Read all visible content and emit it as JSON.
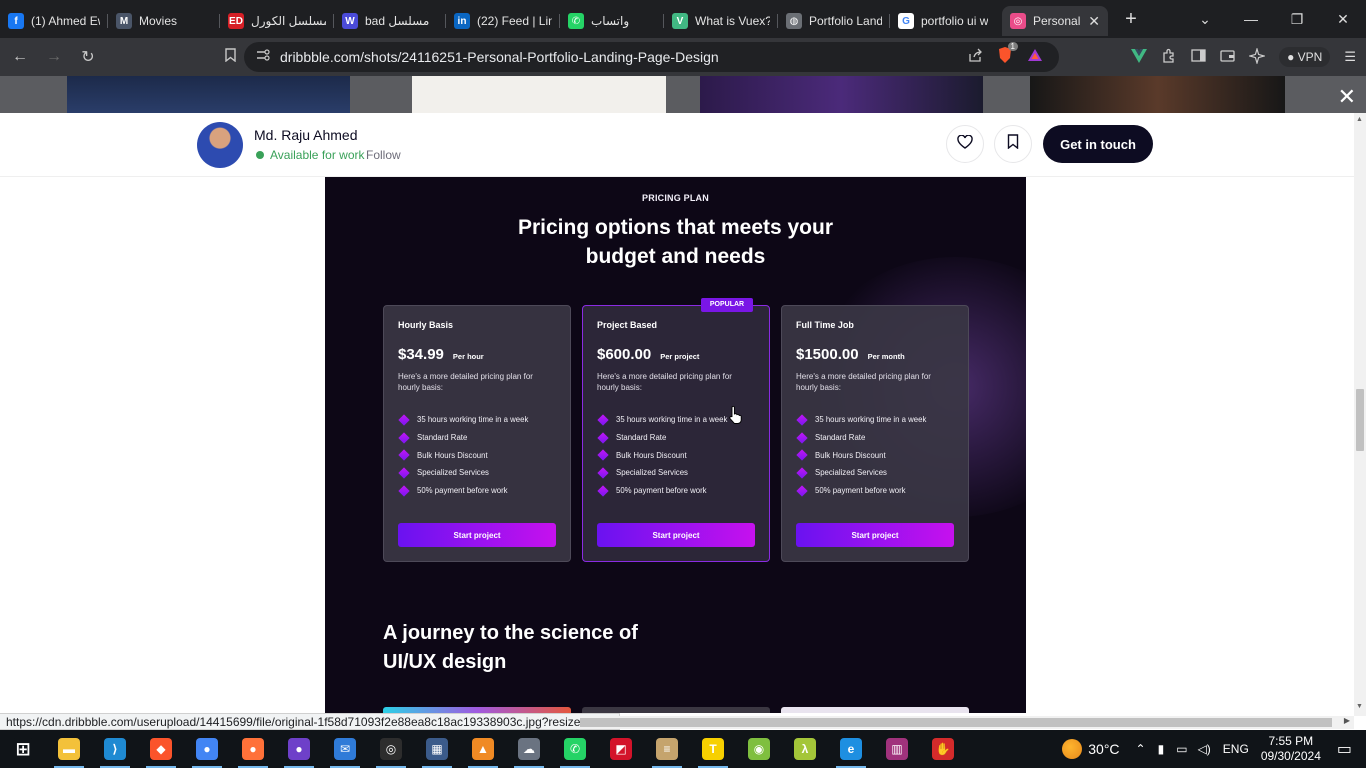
{
  "browser": {
    "tabs": [
      {
        "title": "(1) Ahmed Ew",
        "icon": "facebook-icon",
        "color": "#1877f2",
        "glyph": "f"
      },
      {
        "title": "Movies",
        "icon": "movies-icon",
        "color": "#4a5568",
        "glyph": "M"
      },
      {
        "title": "مسلسل الكورل",
        "icon": "ed-icon",
        "color": "#d61f26",
        "glyph": "ED"
      },
      {
        "title": "bad مسلسل",
        "icon": "w-icon",
        "color": "#4b4bd8",
        "glyph": "W"
      },
      {
        "title": "(22) Feed | Lin",
        "icon": "linkedin-icon",
        "color": "#0a66c2",
        "glyph": "in"
      },
      {
        "title": "واتساب",
        "icon": "whatsapp-icon",
        "color": "#25d366",
        "glyph": "✆"
      },
      {
        "title": "What is Vuex?",
        "icon": "vue-icon",
        "color": "#41b883",
        "glyph": "V"
      },
      {
        "title": "Portfolio Land",
        "icon": "globe-icon",
        "color": "#6b6f75",
        "glyph": "◍"
      },
      {
        "title": "portfolio ui w",
        "icon": "google-icon",
        "color": "#ffffff",
        "glyph": "G"
      },
      {
        "title": "Personal",
        "icon": "dribbble-icon",
        "color": "#ea4c89",
        "glyph": "◎"
      }
    ],
    "url": "dribbble.com/shots/24116251-Personal-Portfolio-Landing-Page-Design",
    "vpn_label": "VPN",
    "brave_badge": "1"
  },
  "shot_header": {
    "designer_name": "Md. Raju Ahmed",
    "availability": "Available for work",
    "follow": "Follow",
    "cta": "Get in touch"
  },
  "shot": {
    "eyebrow": "PRICING PLAN",
    "heading_line1": "Pricing options that meets your",
    "heading_line2": "budget and needs",
    "plans": [
      {
        "name": "Hourly Basis",
        "price": "$34.99",
        "period": "Per hour",
        "desc": "Here's a more detailed pricing plan for hourly basis:",
        "features": [
          "35 hours working time in a week",
          "Standard Rate",
          "Bulk Hours Discount",
          "Specialized Services",
          "50% payment before work"
        ],
        "button": "Start project"
      },
      {
        "name": "Project Based",
        "badge": "POPULAR",
        "price": "$600.00",
        "period": "Per project",
        "desc": "Here's a more detailed pricing plan for hourly basis:",
        "features": [
          "35 hours working time in a week",
          "Standard Rate",
          "Bulk Hours Discount",
          "Specialized Services",
          "50% payment before work"
        ],
        "button": "Start project"
      },
      {
        "name": "Full Time Job",
        "price": "$1500.00",
        "period": "Per month",
        "desc": "Here's a more detailed pricing plan for hourly basis:",
        "features": [
          "35 hours working time in a week",
          "Standard Rate",
          "Bulk Hours Discount",
          "Specialized Services",
          "50% payment before work"
        ],
        "button": "Start project"
      }
    ],
    "journey_line1": "A journey to the science of",
    "journey_line2": "UI/UX design"
  },
  "status_url": "https://cdn.dribbble.com/userupload/14415699/file/original-1f58d71093f2e88ea8c18ac19338903c.jpg?resize=752x",
  "taskbar": {
    "apps": [
      {
        "name": "start",
        "color": "#101418",
        "glyph": "⊞"
      },
      {
        "name": "file-explorer",
        "color": "#f3c13a",
        "glyph": "▬"
      },
      {
        "name": "vscode",
        "color": "#1f8ad2",
        "glyph": "⟩"
      },
      {
        "name": "brave",
        "color": "#fb542b",
        "glyph": "◆"
      },
      {
        "name": "chrome",
        "color": "#4285f4",
        "glyph": "●"
      },
      {
        "name": "firefox",
        "color": "#ff7139",
        "glyph": "●"
      },
      {
        "name": "github-desktop",
        "color": "#6e40c9",
        "glyph": "●"
      },
      {
        "name": "mail",
        "color": "#2f7bd8",
        "glyph": "✉"
      },
      {
        "name": "obs",
        "color": "#2d2d2d",
        "glyph": "◎"
      },
      {
        "name": "davinci",
        "color": "#3b5b8a",
        "glyph": "▦"
      },
      {
        "name": "vlc",
        "color": "#f08a24",
        "glyph": "▲"
      },
      {
        "name": "app-cloud",
        "color": "#6a7381",
        "glyph": "☁"
      },
      {
        "name": "whatsapp",
        "color": "#25d366",
        "glyph": "✆"
      },
      {
        "name": "amd",
        "color": "#d3132a",
        "glyph": "◩"
      },
      {
        "name": "books",
        "color": "#c5a46d",
        "glyph": "≡"
      },
      {
        "name": "typora",
        "color": "#f7d000",
        "glyph": "T"
      },
      {
        "name": "android-studio",
        "color": "#7fbf3f",
        "glyph": "◉"
      },
      {
        "name": "lambda",
        "color": "#a4c639",
        "glyph": "λ"
      },
      {
        "name": "edge",
        "color": "#1e8fe1",
        "glyph": "e"
      },
      {
        "name": "winrar",
        "color": "#a0327c",
        "glyph": "▥"
      },
      {
        "name": "hand-app",
        "color": "#d42b2b",
        "glyph": "✋"
      }
    ],
    "temperature": "30°C",
    "language": "ENG",
    "time": "7:55 PM",
    "date": "09/30/2024"
  }
}
